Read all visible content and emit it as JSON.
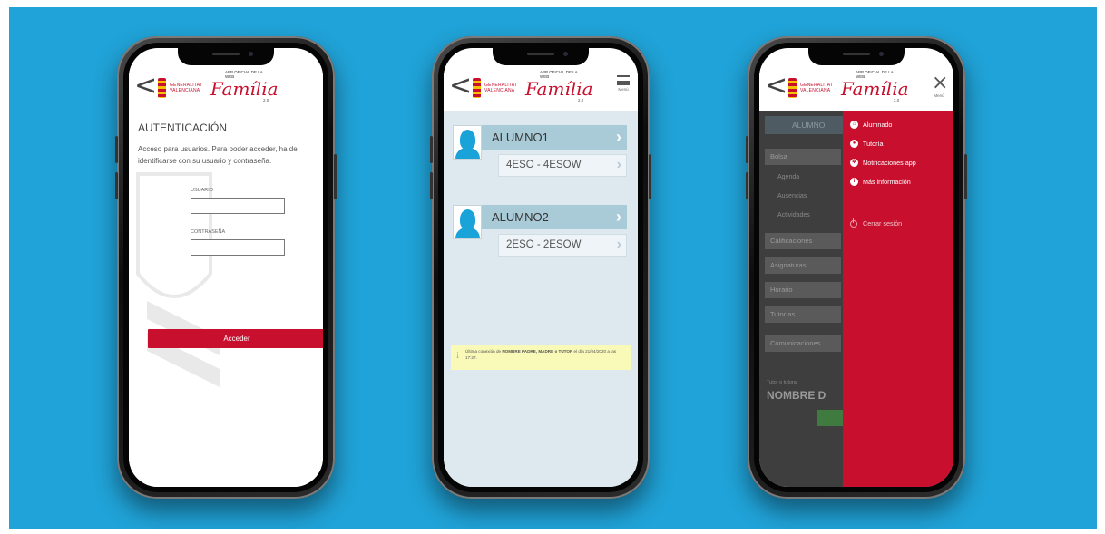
{
  "header": {
    "back_glyph": "<",
    "gv_line1": "GENERALITAT",
    "gv_line2": "VALENCIANA",
    "app_line1": "APP OFICIAL DE LA",
    "app_line2": "WEB",
    "brand": "Família",
    "version": "2.0",
    "menu_label": "Menú"
  },
  "login": {
    "title": "AUTENTICACIÓN",
    "description": "Acceso para usuarios. Para poder acceder, ha de identificarse con su usuario y contraseña.",
    "user_label": "USUARIO",
    "user_value": "",
    "password_label": "CONTRASEÑA",
    "password_value": "",
    "submit": "Acceder"
  },
  "students": {
    "items": [
      {
        "name": "ALUMNO1",
        "group": "4ESO - 4ESOW"
      },
      {
        "name": "ALUMNO2",
        "group": "2ESO - 2ESOW"
      }
    ],
    "notice_pre": "Última conexión de ",
    "notice_bold1": "NOMBRE PADRE, MADRE o TUTOR",
    "notice_mid": " el día 21/04/2020 a las 17:27."
  },
  "drawer": {
    "items": [
      {
        "label": "Alumnado",
        "icon": "home-icon"
      },
      {
        "label": "Tutoría",
        "icon": "user-icon"
      },
      {
        "label": "Notificaciones app",
        "icon": "gear-icon"
      },
      {
        "label": "Más información",
        "icon": "info-icon"
      }
    ],
    "logout": "Cerrar sesión",
    "background": {
      "header": "ALUMNO",
      "rows": [
        "Bolsa",
        "Calificaciones",
        "Asignaturas",
        "Horario",
        "Tutorías",
        "Comunicaciones"
      ],
      "subs": [
        "Agenda",
        "Ausencias",
        "Actividades"
      ],
      "tutor_small": "Tutor o tutora",
      "tutor_big": "NOMBRE D"
    }
  },
  "colors": {
    "stage": "#20a3d8",
    "brand_red": "#c8102e",
    "student_bar": "#a9cbd7",
    "avatar_blue": "#1aa3d9"
  }
}
